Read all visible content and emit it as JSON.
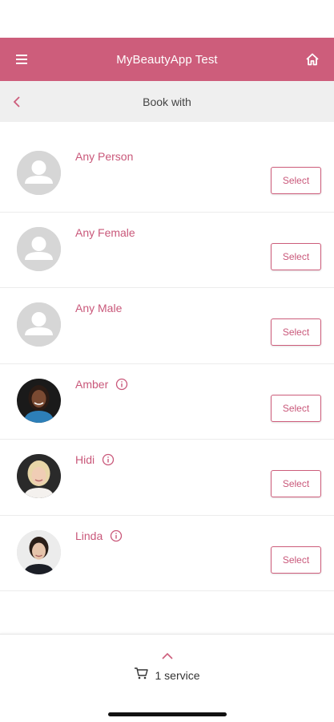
{
  "header": {
    "title": "MyBeautyApp Test",
    "menu_icon": "menu-icon",
    "home_icon": "home-icon"
  },
  "subheader": {
    "title": "Book with",
    "back_icon": "chevron-left-icon"
  },
  "staff": [
    {
      "name": "Any Person",
      "select_label": "Select",
      "info": false,
      "avatar": "placeholder"
    },
    {
      "name": "Any Female",
      "select_label": "Select",
      "info": false,
      "avatar": "placeholder"
    },
    {
      "name": "Any Male",
      "select_label": "Select",
      "info": false,
      "avatar": "placeholder"
    },
    {
      "name": "Amber",
      "select_label": "Select",
      "info": true,
      "avatar": "photo"
    },
    {
      "name": "Hidi",
      "select_label": "Select",
      "info": true,
      "avatar": "photo"
    },
    {
      "name": "Linda",
      "select_label": "Select",
      "info": true,
      "avatar": "photo"
    }
  ],
  "footer": {
    "cart_text": "1 service",
    "cart_icon": "cart-icon",
    "expand_icon": "chevron-up-icon"
  },
  "colors": {
    "brand": "#cd5d7b",
    "brand_text": "#c9587a",
    "subheader_bg": "#efefef"
  }
}
